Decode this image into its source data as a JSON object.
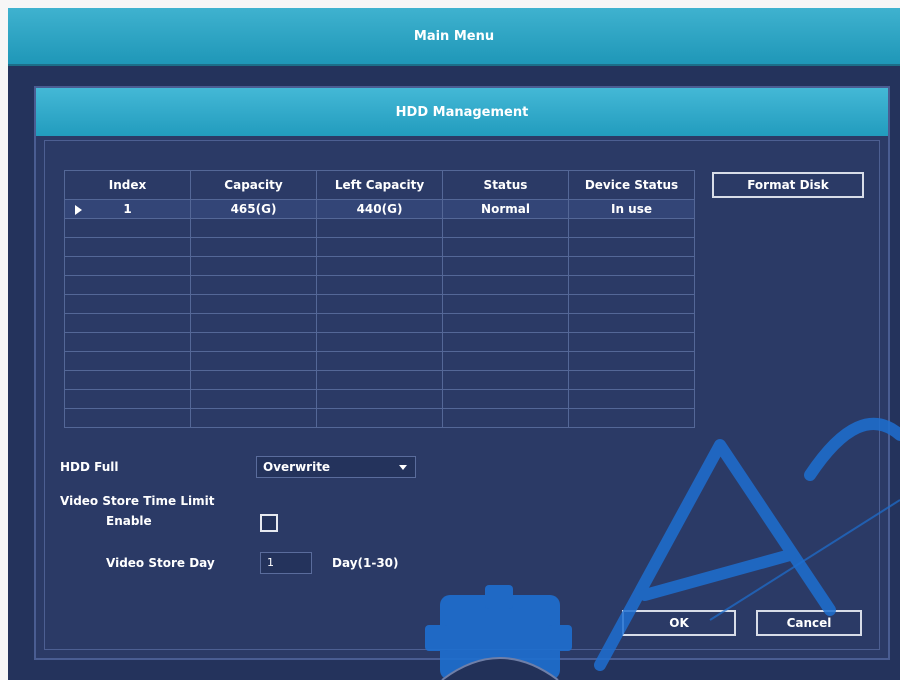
{
  "main_menu": {
    "title": "Main Menu"
  },
  "dialog": {
    "title": "HDD Management",
    "format_button": "Format Disk",
    "ok_button": "OK",
    "cancel_button": "Cancel"
  },
  "table": {
    "headers": {
      "index": "Index",
      "capacity": "Capacity",
      "left_capacity": "Left Capacity",
      "status": "Status",
      "device_status": "Device Status"
    },
    "rows": [
      {
        "index": "1",
        "capacity": "465(G)",
        "left_capacity": "440(G)",
        "status": "Normal",
        "device_status": "In use"
      }
    ]
  },
  "settings": {
    "hdd_full_label": "HDD Full",
    "hdd_full_value": "Overwrite",
    "video_store_time_limit_label": "Video Store Time Limit",
    "enable_label": "Enable",
    "enable_checked": false,
    "video_store_day_label": "Video Store Day",
    "video_store_day_value": "1",
    "day_range_label": "Day(1-30)"
  },
  "colors": {
    "background": "#24335c",
    "title_bar": "#2aa8c9",
    "text": "#ffffff",
    "watermark": "#1e6fd0"
  },
  "icons": {
    "row_pointer": "play-arrow-icon",
    "dropdown_caret": "chevron-down-icon"
  }
}
